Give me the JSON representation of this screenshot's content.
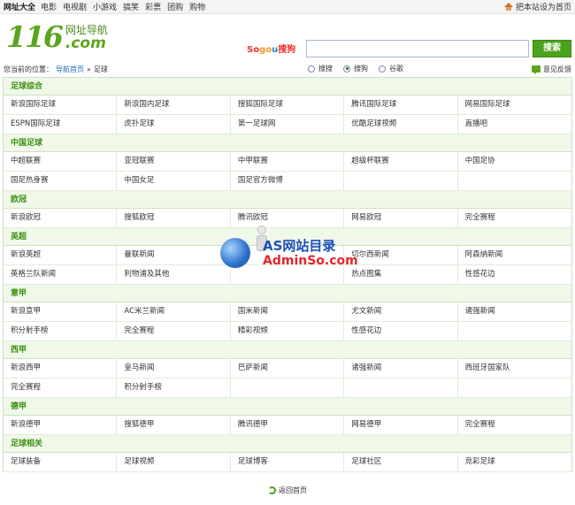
{
  "topbar": {
    "brand": "网址大全",
    "links": [
      "电影",
      "电视剧",
      "小游戏",
      "搞笑",
      "彩票",
      "团购",
      "购物"
    ],
    "set_home": "把本站设为首页"
  },
  "logo": {
    "number": "116",
    "cn": "网址导航",
    "com": ".com"
  },
  "search": {
    "brand_parts": [
      "So",
      "go",
      "u",
      "搜狗"
    ],
    "value": "",
    "button": "搜索",
    "engines": [
      {
        "label": "搜搜",
        "selected": false
      },
      {
        "label": "搜狗",
        "selected": true
      },
      {
        "label": "谷歌",
        "selected": false
      }
    ]
  },
  "breadcrumb": {
    "prefix": "您当前的位置：",
    "home": "导航首页",
    "sep": "»",
    "current": "足球",
    "feedback": "意见反馈"
  },
  "sections": [
    {
      "title": "足球综合",
      "rows": [
        [
          "新浪国际足球",
          "新浪国内足球",
          "搜狐国际足球",
          "腾讯国际足球",
          "网易国际足球"
        ],
        [
          "ESPN国际足球",
          "虎扑足球",
          "第一足球网",
          "优酷足球视频",
          "直播吧"
        ]
      ]
    },
    {
      "title": "中国足球",
      "rows": [
        [
          "中超联赛",
          "亚冠联赛",
          "中甲联赛",
          "超级杯联赛",
          "中国足协"
        ],
        [
          "国足热身赛",
          "中国女足",
          "国足官方微博",
          "",
          ""
        ]
      ]
    },
    {
      "title": "欧冠",
      "rows": [
        [
          "新浪欧冠",
          "搜狐欧冠",
          "腾讯欧冠",
          "网易欧冠",
          "完全赛程"
        ]
      ]
    },
    {
      "title": "英超",
      "rows": [
        [
          "新浪英超",
          "曼联新闻",
          "",
          "切尔西新闻",
          "阿森纳新闻"
        ],
        [
          "英格兰队新闻",
          "利物浦及其他",
          "",
          "热点图集",
          "性感花边"
        ]
      ]
    },
    {
      "title": "意甲",
      "rows": [
        [
          "新浪意甲",
          "AC米兰新闻",
          "国米新闻",
          "尤文新闻",
          "诸强新闻"
        ],
        [
          "积分射手榜",
          "完全赛程",
          "精彩视频",
          "性感花边",
          ""
        ]
      ]
    },
    {
      "title": "西甲",
      "rows": [
        [
          "新浪西甲",
          "皇马新闻",
          "巴萨新闻",
          "诸强新闻",
          "西班牙国家队"
        ],
        [
          "完全赛程",
          "积分射手榜",
          "",
          "",
          ""
        ]
      ]
    },
    {
      "title": "德甲",
      "rows": [
        [
          "新浪德甲",
          "搜狐德甲",
          "腾讯德甲",
          "网易德甲",
          "完全赛程"
        ]
      ]
    },
    {
      "title": "足球相关",
      "rows": [
        [
          "足球装备",
          "足球视频",
          "足球博客",
          "足球社区",
          "竞彩足球"
        ]
      ]
    }
  ],
  "footer": {
    "back_home": "返回首页"
  },
  "watermark": {
    "line1": "AS网站目录",
    "line2": "AdminSo.com"
  }
}
